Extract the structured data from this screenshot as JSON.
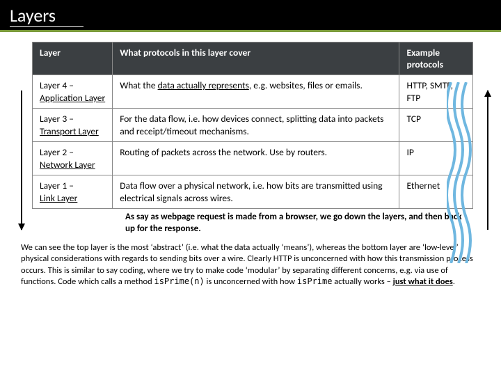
{
  "title": "Layers",
  "headers": {
    "c1": "Layer",
    "c2": "What protocols in this layer cover",
    "c3": "Example protocols"
  },
  "rows": [
    {
      "num": "Layer 4 –",
      "name": "Application Layer",
      "desc_a": "What the ",
      "desc_u": "data actually represents",
      "desc_b": ", e.g. websites, files or emails.",
      "ex": "HTTP, SMTP, FTP"
    },
    {
      "num": "Layer 3 –",
      "name": "Transport Layer",
      "desc_a": "For the data flow, i.e. how devices connect, splitting data into packets and receipt/timeout mechanisms.",
      "desc_u": "",
      "desc_b": "",
      "ex": "TCP"
    },
    {
      "num": "Layer 2 –",
      "name": "Network Layer",
      "desc_a": "Routing of packets across the network. Use by routers.",
      "desc_u": "",
      "desc_b": "",
      "ex": "IP"
    },
    {
      "num": "Layer 1 –",
      "name": "Link Layer",
      "desc_a": "Data flow over a physical network, i.e. how bits are transmitted using electrical signals across wires.",
      "desc_u": "",
      "desc_b": "",
      "ex": "Ethernet"
    }
  ],
  "caption": "As say as webpage request is made from a browser, we go down the layers, and then back up for the response.",
  "para": {
    "a": "We can see the top layer is the most ‘abstract’ (i.e. what the data actually ‘means’), whereas the bottom layer are ‘low-level’ physical considerations with regards to sending bits over a wire. Clearly HTTP is unconcerned with how this transmission process occurs. This is similar to say coding, where we try to make code ‘modular’ by separating different concerns, e.g. via use of functions. Code which calls a method ",
    "code1": "isPrime(n)",
    "b": " is unconcerned with how ",
    "code2": "isPrime",
    "c": " actually works – ",
    "u": "just what it does",
    "d": "."
  }
}
